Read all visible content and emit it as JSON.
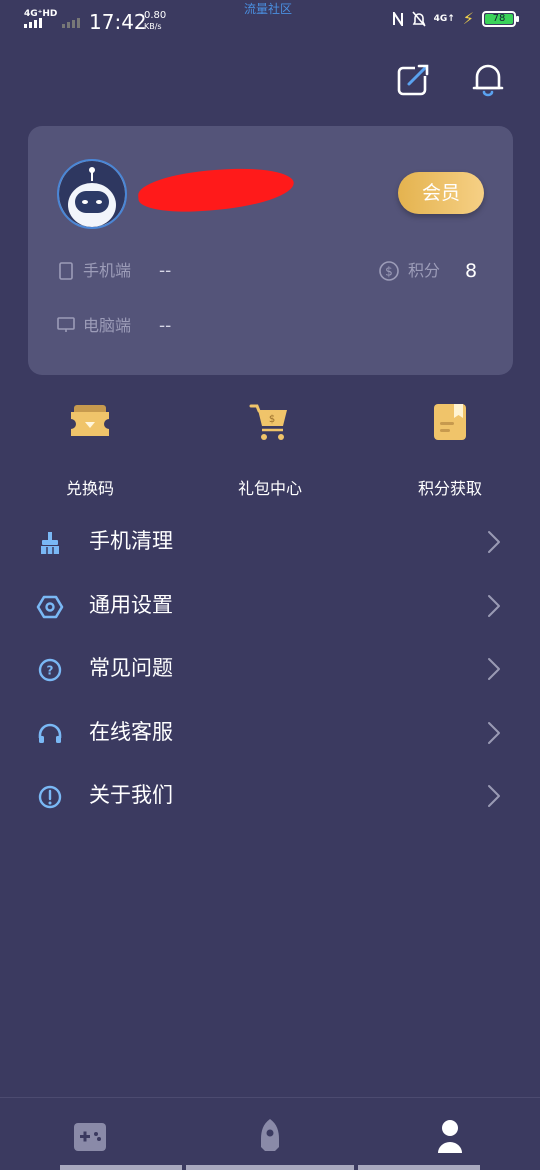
{
  "status_bar": {
    "network": "4G⁺HD",
    "time": "17:42",
    "speed_value": "0.80",
    "speed_unit": "KB/s",
    "app_name": "流量社区",
    "network_right": "4G↑",
    "battery": "78"
  },
  "profile": {
    "member_label": "会员",
    "phone_label": "手机端",
    "phone_value": "--",
    "pc_label": "电脑端",
    "pc_value": "--",
    "points_label": "积分",
    "points_value": "8"
  },
  "quick_actions": [
    {
      "label": "兑换码",
      "icon": "ticket-icon"
    },
    {
      "label": "礼包中心",
      "icon": "cart-icon"
    },
    {
      "label": "积分获取",
      "icon": "bookmark-icon"
    }
  ],
  "menu": [
    {
      "label": "手机清理",
      "icon": "broom-icon"
    },
    {
      "label": "通用设置",
      "icon": "hexagon-settings-icon"
    },
    {
      "label": "常见问题",
      "icon": "question-icon"
    },
    {
      "label": "在线客服",
      "icon": "headset-icon"
    },
    {
      "label": "关于我们",
      "icon": "info-icon"
    }
  ],
  "bottom_nav": [
    {
      "icon": "gamepad-icon",
      "active": false
    },
    {
      "icon": "rocket-icon",
      "active": false
    },
    {
      "icon": "user-icon",
      "active": true
    }
  ],
  "colors": {
    "background": "#3b3a60",
    "card": "#545479",
    "accent_gold": "#f0c46a",
    "icon_blue": "#7ab8f5"
  }
}
